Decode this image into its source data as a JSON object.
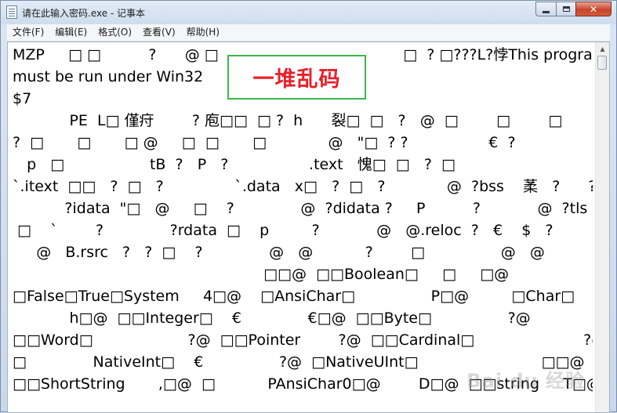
{
  "window": {
    "title": "请在此输入密码.exe - 记事本",
    "minimize_glyph": "",
    "maximize_glyph": "",
    "close_glyph": "✕"
  },
  "menu": [
    {
      "label": "文件(F)"
    },
    {
      "label": "编辑(E)"
    },
    {
      "label": "格式(O)"
    },
    {
      "label": "查看(V)"
    },
    {
      "label": "帮助(H)"
    }
  ],
  "editor": {
    "lines": [
      "MZP     □ □          ?      @ □                                       □  ? □???L?悖This program",
      "must be run under Win32",
      "$7",
      "            PE  L□ 僅疛        ? 庖□□  □ ?  h      裂□  □   ?   @  □        □        □",
      "?  □       □       □ @     □  □       □             @   \"□  ? ?                 €  ?",
      "   p   □                  tB  ?   P   ?                 .text   愧□  □   ?  □",
      "`.itext  □□   ?  □   ?               `.data   x□   ?  □   ?             @  ?bss    葇   ?      ?",
      "           ?idata  \"□   @     □    ?              @  ?didata ?     P          ?            @  ?tls",
      " □    `        ?              ?rdata  □    p         ?            @   @.reloc  ?   €    $   ?",
      "     @   B.rsrc   ?   ?  □    ?              @   @           ?        □                @   @",
      "                                                     □□@  □□Boolean□     □     □@",
      "□False□True□System     4□@    □AnsiChar□                P□@         □Char□",
      "            h□@  □□Integer□    €              €□@  □□Byte□                ?@",
      "□□Word□                    ?@  □□Pointer        ?@  □□Cardinal□                       ?@",
      "□              NativeInt□    €                ?@  □NativeUInt□                          □□@",
      "□□ShortString       ,□@  □           PAnsiChar0□@        D□@  □□string     T□@"
    ]
  },
  "annotation": {
    "text": "一堆乱码",
    "border_color": "#3db64a",
    "text_color": "#e8202a"
  },
  "watermark": {
    "text": "Bai du 经验"
  },
  "scrollbar": {
    "up_arrow": "▲",
    "down_arrow": "▼"
  }
}
